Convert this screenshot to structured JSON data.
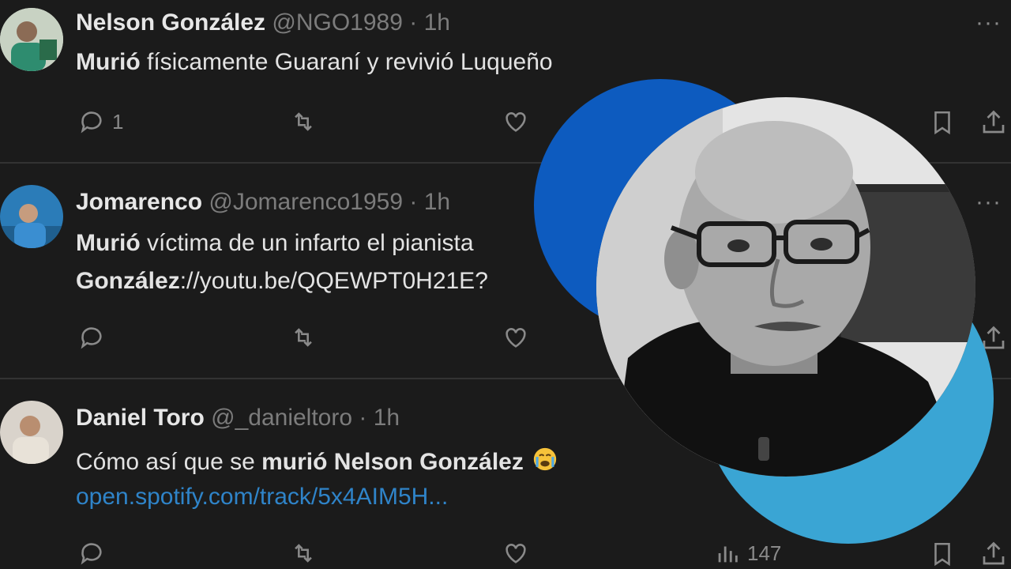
{
  "tweets": [
    {
      "name": "Nelson González",
      "handle": "@NGO1989",
      "dot": "·",
      "time": "1h",
      "text_bold": "Murió",
      "text_rest": " físicamente Guaraní y revivió Luqueño",
      "reply_count": "1",
      "more": "···"
    },
    {
      "name": "Jomarenco",
      "handle": "@Jomarenco1959",
      "dot": "·",
      "time": "1h",
      "text_bold": "Murió",
      "text_rest": " víctima de un infarto el pianista",
      "line2_bold": "González",
      "line2_rest": "://youtu.be/QQEWPT0H21E?",
      "more": "···"
    },
    {
      "name": "Daniel Toro",
      "handle": "@_danieltoro",
      "dot": "·",
      "time": "1h",
      "text_plain": "Cómo así que se ",
      "text_bold": "murió Nelson González",
      "link": "open.spotify.com/track/5x4AIM5H...",
      "views": "147",
      "more": "···"
    }
  ],
  "overlay": {
    "accent_dark": "#0d5bbf",
    "accent_light": "#3aa5d4"
  }
}
